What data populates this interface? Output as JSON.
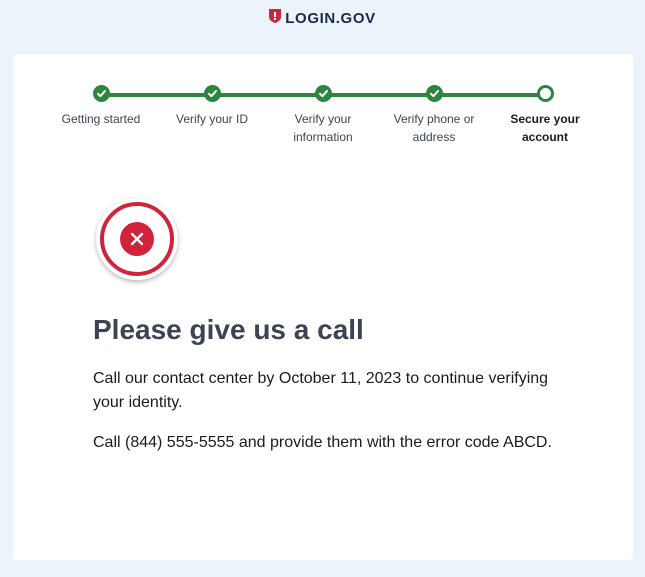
{
  "header": {
    "logo_text": "LOGIN.GOV",
    "logo_icon": "shield-icon"
  },
  "stepper": {
    "steps": [
      {
        "label_lines": [
          "Getting started"
        ],
        "status": "complete"
      },
      {
        "label_lines": [
          "Verify your ID"
        ],
        "status": "complete"
      },
      {
        "label_lines": [
          "Verify your",
          "information"
        ],
        "status": "complete"
      },
      {
        "label_lines": [
          "Verify phone or",
          "address"
        ],
        "status": "complete"
      },
      {
        "label_lines": [
          "Secure your",
          "account"
        ],
        "status": "current"
      }
    ],
    "colors": {
      "complete": "#2e8540"
    }
  },
  "error": {
    "icon": "error-x-icon",
    "color": "#d0233c"
  },
  "main": {
    "title": "Please give us a call",
    "paragraph1": "Call our contact center by October 11, 2023 to continue verifying your identity.",
    "paragraph2": "Call (844) 555-5555 and provide them with the error code ABCD."
  }
}
